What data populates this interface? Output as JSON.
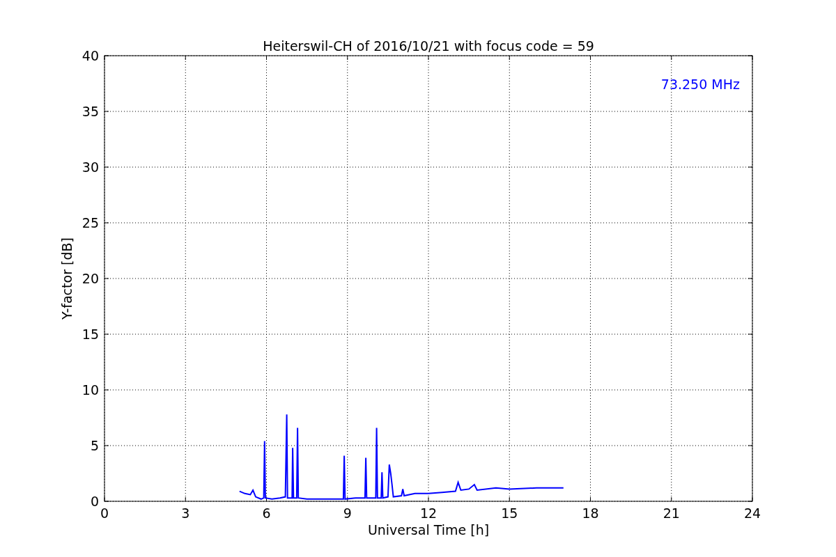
{
  "chart_data": {
    "type": "line",
    "title": "Heiterswil-CH of 2016/10/21 with focus code = 59",
    "xlabel": "Universal Time [h]",
    "ylabel": "Y-factor [dB]",
    "grid": true,
    "xlim": [
      0,
      24
    ],
    "ylim": [
      0,
      40
    ],
    "xticks": [
      0,
      3,
      6,
      9,
      12,
      15,
      18,
      21,
      24
    ],
    "yticks": [
      0,
      5,
      10,
      15,
      20,
      25,
      30,
      35,
      40
    ],
    "x": [
      5.0,
      5.2,
      5.4,
      5.5,
      5.6,
      5.8,
      5.9,
      5.93,
      5.96,
      6.2,
      6.5,
      6.7,
      6.75,
      6.78,
      6.95,
      6.97,
      7.0,
      7.12,
      7.15,
      7.18,
      7.5,
      8.0,
      8.5,
      8.85,
      8.88,
      8.91,
      9.3,
      9.65,
      9.68,
      9.71,
      10.05,
      10.08,
      10.11,
      10.25,
      10.28,
      10.31,
      10.5,
      10.55,
      10.6,
      10.65,
      10.7,
      11.0,
      11.05,
      11.1,
      11.5,
      12.0,
      12.5,
      13.0,
      13.1,
      13.2,
      13.5,
      13.7,
      13.8,
      14.5,
      15.0,
      16.0,
      17.0
    ],
    "series": [
      {
        "name": "73.250 MHz",
        "color": "#0000ff",
        "values": [
          0.9,
          0.7,
          0.6,
          1.0,
          0.4,
          0.2,
          0.3,
          5.4,
          0.3,
          0.2,
          0.3,
          0.4,
          7.8,
          0.3,
          0.3,
          4.8,
          0.3,
          0.3,
          6.6,
          0.3,
          0.2,
          0.2,
          0.2,
          0.2,
          4.1,
          0.2,
          0.3,
          0.3,
          3.9,
          0.3,
          0.3,
          6.6,
          0.3,
          0.3,
          2.6,
          0.3,
          0.4,
          3.3,
          2.5,
          1.5,
          0.4,
          0.5,
          1.1,
          0.5,
          0.7,
          0.7,
          0.8,
          0.9,
          1.7,
          1.0,
          1.1,
          1.5,
          1.0,
          1.2,
          1.1,
          1.2,
          1.2
        ]
      }
    ]
  }
}
